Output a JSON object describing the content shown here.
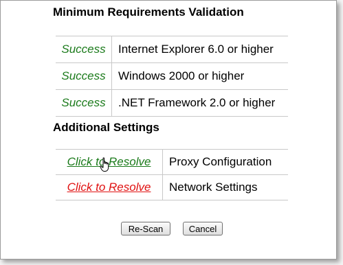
{
  "requirements": {
    "title": "Minimum Requirements Validation",
    "items": [
      {
        "status": "Success",
        "label": "Internet Explorer 6.0 or higher"
      },
      {
        "status": "Success",
        "label": "Windows 2000 or higher"
      },
      {
        "status": "Success",
        "label": ".NET Framework 2.0 or higher"
      }
    ]
  },
  "additional": {
    "title": "Additional Settings",
    "items": [
      {
        "action": "Click to Resolve",
        "label": "Proxy Configuration",
        "state_color": "#1a7a1a"
      },
      {
        "action": "Click to Resolve",
        "label": "Network Settings",
        "state_color": "#e01010"
      }
    ]
  },
  "buttons": {
    "rescan": "Re-Scan",
    "cancel": "Cancel"
  },
  "colors": {
    "success": "#1a7a1a",
    "error": "#e01010"
  },
  "icons": {
    "cursor": "hand-pointer-icon"
  }
}
